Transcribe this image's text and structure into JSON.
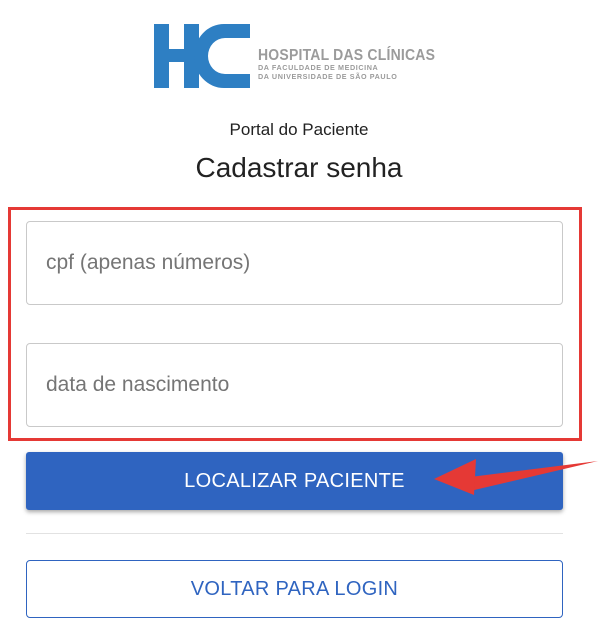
{
  "logo": {
    "mark": "HC",
    "line1": "HOSPITAL DAS CLÍNICAS",
    "line2": "DA FACULDADE DE MEDICINA",
    "line3": "DA UNIVERSIDADE DE SÃO PAULO",
    "brand_color": "#2e7fc3",
    "text_color": "#9b9b9b"
  },
  "header": {
    "portal_title": "Portal do Paciente",
    "page_title": "Cadastrar senha"
  },
  "form": {
    "cpf": {
      "placeholder": "cpf (apenas números)",
      "value": ""
    },
    "birth_date": {
      "placeholder": "data de nascimento",
      "value": ""
    },
    "submit_label": "LOCALIZAR PACIENTE",
    "back_label": "VOLTAR PARA LOGIN"
  },
  "annotation": {
    "highlight_color": "#e53935",
    "arrow_color": "#e53935"
  },
  "colors": {
    "primary": "#2f64c0",
    "text": "#222222"
  }
}
